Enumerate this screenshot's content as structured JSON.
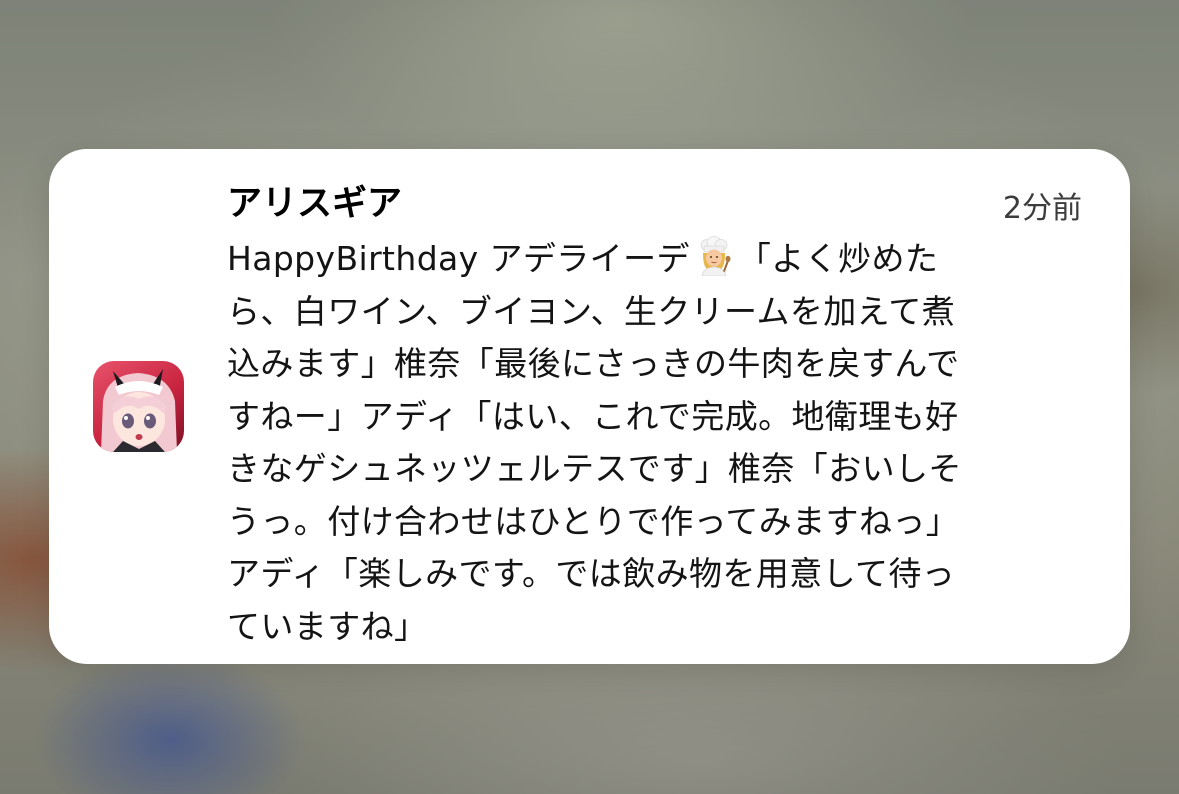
{
  "notification": {
    "app_name": "アリスギア",
    "time": "2分前",
    "icon": "app-icon-anime-character",
    "body_line_1_before_emoji": "HappyBirthday アデライーデ",
    "emoji": "cook-emoji",
    "body_line_1_after_emoji": "「よく炒めた",
    "body_lines": [
      "ら、白ワイン、ブイヨン、生クリームを加えて煮",
      "込みます」椎奈「最後にさっきの牛肉を戻すんで",
      "すねー」アディ「はい、これで完成。地衛理も好",
      "きなゲシュネッツェルテスです」椎奈「おいしそ",
      "うっ。付け合わせはひとりで作ってみますねっ」",
      "アディ「楽しみです。では飲み物を用意して待っ",
      "ていますね」"
    ]
  },
  "colors": {
    "card_background": "#ffffff",
    "title_text": "#000000",
    "body_text": "#141414",
    "time_text": "#3c3c3e",
    "icon_accent": "#d0304a"
  }
}
